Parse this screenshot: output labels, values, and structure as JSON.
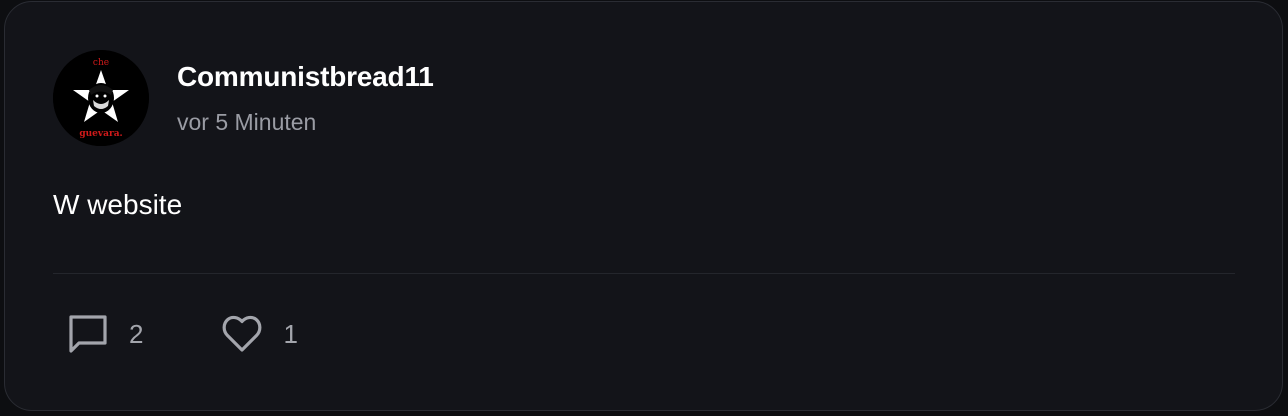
{
  "post": {
    "author": {
      "username": "Communistbread11",
      "avatar": {
        "icon": "che-guevara-avatar",
        "text_top": "che",
        "text_bottom": "guevara."
      }
    },
    "timestamp": "vor 5 Minuten",
    "body": "W website",
    "actions": {
      "comments": {
        "icon": "comment-icon",
        "count": "2"
      },
      "likes": {
        "icon": "heart-icon",
        "count": "1"
      }
    }
  },
  "colors": {
    "background": "#0d0e11",
    "card": "#131419",
    "text": "#ffffff",
    "muted": "#9a9ca4",
    "avatar_accent": "#d11a1a"
  }
}
